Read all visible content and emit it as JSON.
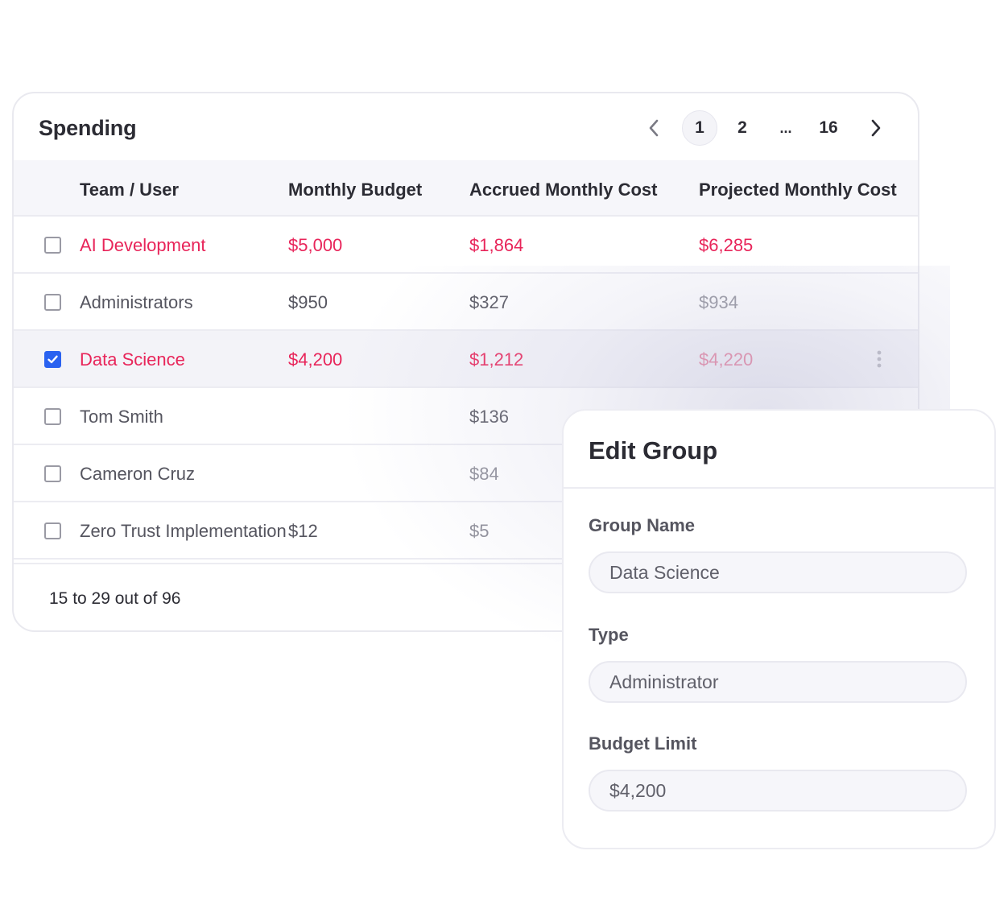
{
  "spending": {
    "title": "Spending",
    "pagination": {
      "prev_icon": "chevron-left-icon",
      "pages": [
        "1",
        "2",
        "...",
        "16"
      ],
      "current": "1",
      "next_icon": "chevron-right-icon"
    },
    "columns": [
      "Team / User",
      "Monthly Budget",
      "Accrued Monthly Cost",
      "Projected Monthly Cost"
    ],
    "rows": [
      {
        "name": "AI Development",
        "budget": "$5,000",
        "accrued": "$1,864",
        "projected": "$6,285",
        "checked": false,
        "over_budget": true
      },
      {
        "name": "Administrators",
        "budget": "$950",
        "accrued": "$327",
        "projected": "$934",
        "checked": false,
        "over_budget": false
      },
      {
        "name": "Data Science",
        "budget": "$4,200",
        "accrued": "$1,212",
        "projected": "$4,220",
        "checked": true,
        "over_budget": true
      },
      {
        "name": "Tom Smith",
        "budget": "",
        "accrued": "$136",
        "projected": "",
        "checked": false,
        "over_budget": false
      },
      {
        "name": "Cameron Cruz",
        "budget": "",
        "accrued": "$84",
        "projected": "",
        "checked": false,
        "over_budget": false
      },
      {
        "name": "Zero Trust Implementation",
        "budget": "$12",
        "accrued": "$5",
        "projected": "",
        "checked": false,
        "over_budget": false
      }
    ],
    "footer": "15 to 29 out of 96",
    "colors": {
      "alert": "#e8255a",
      "checkbox_on": "#2a62f0"
    }
  },
  "edit_group": {
    "title": "Edit Group",
    "fields": [
      {
        "label": "Group Name",
        "value": "Data Science"
      },
      {
        "label": "Type",
        "value": "Administrator"
      },
      {
        "label": "Budget Limit",
        "value": "$4,200"
      }
    ]
  }
}
